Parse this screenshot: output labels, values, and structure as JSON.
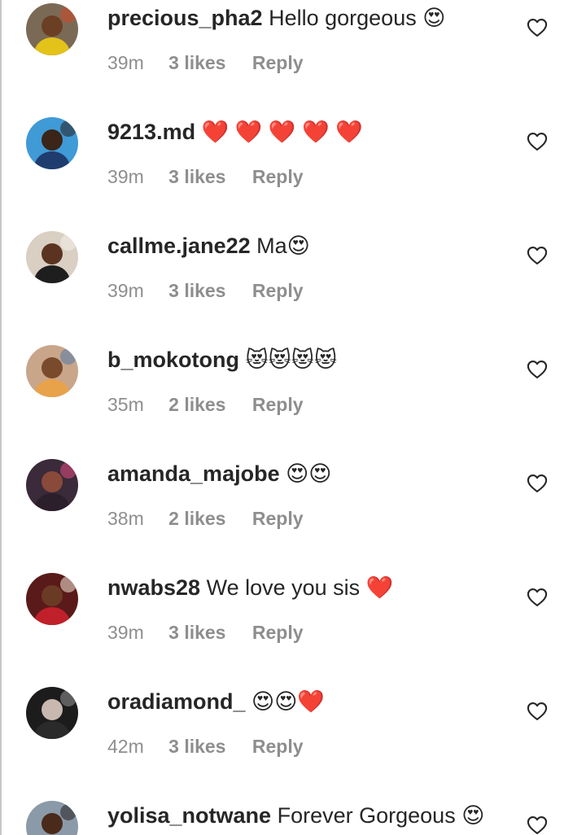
{
  "comments": [
    {
      "username": "precious_pha2",
      "text": "Hello gorgeous 😍",
      "time": "39m",
      "likes": "3 likes",
      "reply": "Reply",
      "avatar": {
        "bg": "#7a6a55",
        "skin": "#6b3f24",
        "shirt": "#e3c21a",
        "accent": "#c94a2a"
      }
    },
    {
      "username": "9213.md",
      "text": "❤️ ❤️ ❤️ ❤️ ❤️",
      "time": "39m",
      "likes": "3 likes",
      "reply": "Reply",
      "avatar": {
        "bg": "#3f9ad6",
        "skin": "#3b2418",
        "shirt": "#1f3c6e",
        "accent": "#2a2a2a"
      }
    },
    {
      "username": "callme.jane22",
      "text": "Ma😍",
      "time": "39m",
      "likes": "3 likes",
      "reply": "Reply",
      "avatar": {
        "bg": "#d9cfc2",
        "skin": "#5a3420",
        "shirt": "#1e1e1e",
        "accent": "#f0ece6"
      }
    },
    {
      "username": "b_mokotong",
      "text": "😻😻😻😻",
      "time": "35m",
      "likes": "2 likes",
      "reply": "Reply",
      "avatar": {
        "bg": "#c9a58a",
        "skin": "#7a4a2c",
        "shirt": "#e8a24a",
        "accent": "#5c7fa8"
      }
    },
    {
      "username": "amanda_majobe",
      "text": "😍😍",
      "time": "38m",
      "likes": "2 likes",
      "reply": "Reply",
      "avatar": {
        "bg": "#3a2a3a",
        "skin": "#8a4a3a",
        "shirt": "#2a1f2a",
        "accent": "#d44a7a"
      }
    },
    {
      "username": "nwabs28",
      "text": "We love you sis ❤️",
      "time": "39m",
      "likes": "3 likes",
      "reply": "Reply",
      "avatar": {
        "bg": "#5a1a1a",
        "skin": "#6b3a24",
        "shirt": "#c0202a",
        "accent": "#e8d8c8"
      }
    },
    {
      "username": "oradiamond_",
      "text": "😍😍❤️",
      "time": "42m",
      "likes": "3 likes",
      "reply": "Reply",
      "avatar": {
        "bg": "#1c1c1c",
        "skin": "#c8b8b0",
        "shirt": "#2a2a2a",
        "accent": "#8a8a8a"
      }
    },
    {
      "username": "yolisa_notwane",
      "text": "Forever Gorgeous 😍",
      "time": "",
      "likes": "",
      "reply": "",
      "avatar": {
        "bg": "#8a9aa8",
        "skin": "#4a2a1a",
        "shirt": "#e8e8e8",
        "accent": "#2a2a2a"
      }
    }
  ],
  "like_icon": "heart-outline-icon",
  "colors": {
    "text": "#262626",
    "meta": "#8e8e8e",
    "background": "#ffffff"
  }
}
